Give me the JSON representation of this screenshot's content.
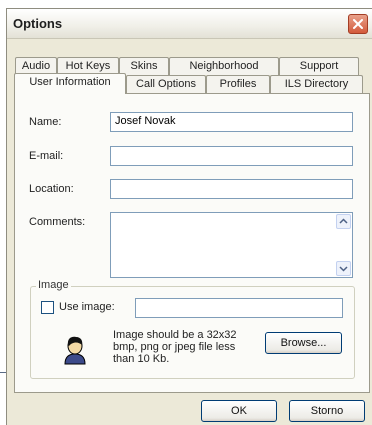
{
  "window": {
    "title": "Options",
    "close_icon": "close-icon"
  },
  "tabs_row1": [
    {
      "label": "Audio"
    },
    {
      "label": "Hot Keys"
    },
    {
      "label": "Skins"
    },
    {
      "label": "Neighborhood"
    },
    {
      "label": "Support"
    }
  ],
  "tabs_row2": [
    {
      "label": "User Information",
      "active": true
    },
    {
      "label": "Call Options"
    },
    {
      "label": "Profiles"
    },
    {
      "label": "ILS Directory"
    }
  ],
  "form": {
    "name_label": "Name:",
    "name_value": "Josef Novak",
    "email_label": "E-mail:",
    "email_value": "",
    "location_label": "Location:",
    "location_value": "",
    "comments_label": "Comments:",
    "comments_value": ""
  },
  "image_group": {
    "title": "Image",
    "use_image_label": "Use image:",
    "use_image_checked": false,
    "image_path_value": "",
    "hint": "Image should be a 32x32 bmp, png or jpeg file less than 10 Kb.",
    "browse_label": "Browse...",
    "avatar_icon": "user-avatar-icon"
  },
  "footer": {
    "ok_label": "OK",
    "cancel_label": "Storno"
  }
}
